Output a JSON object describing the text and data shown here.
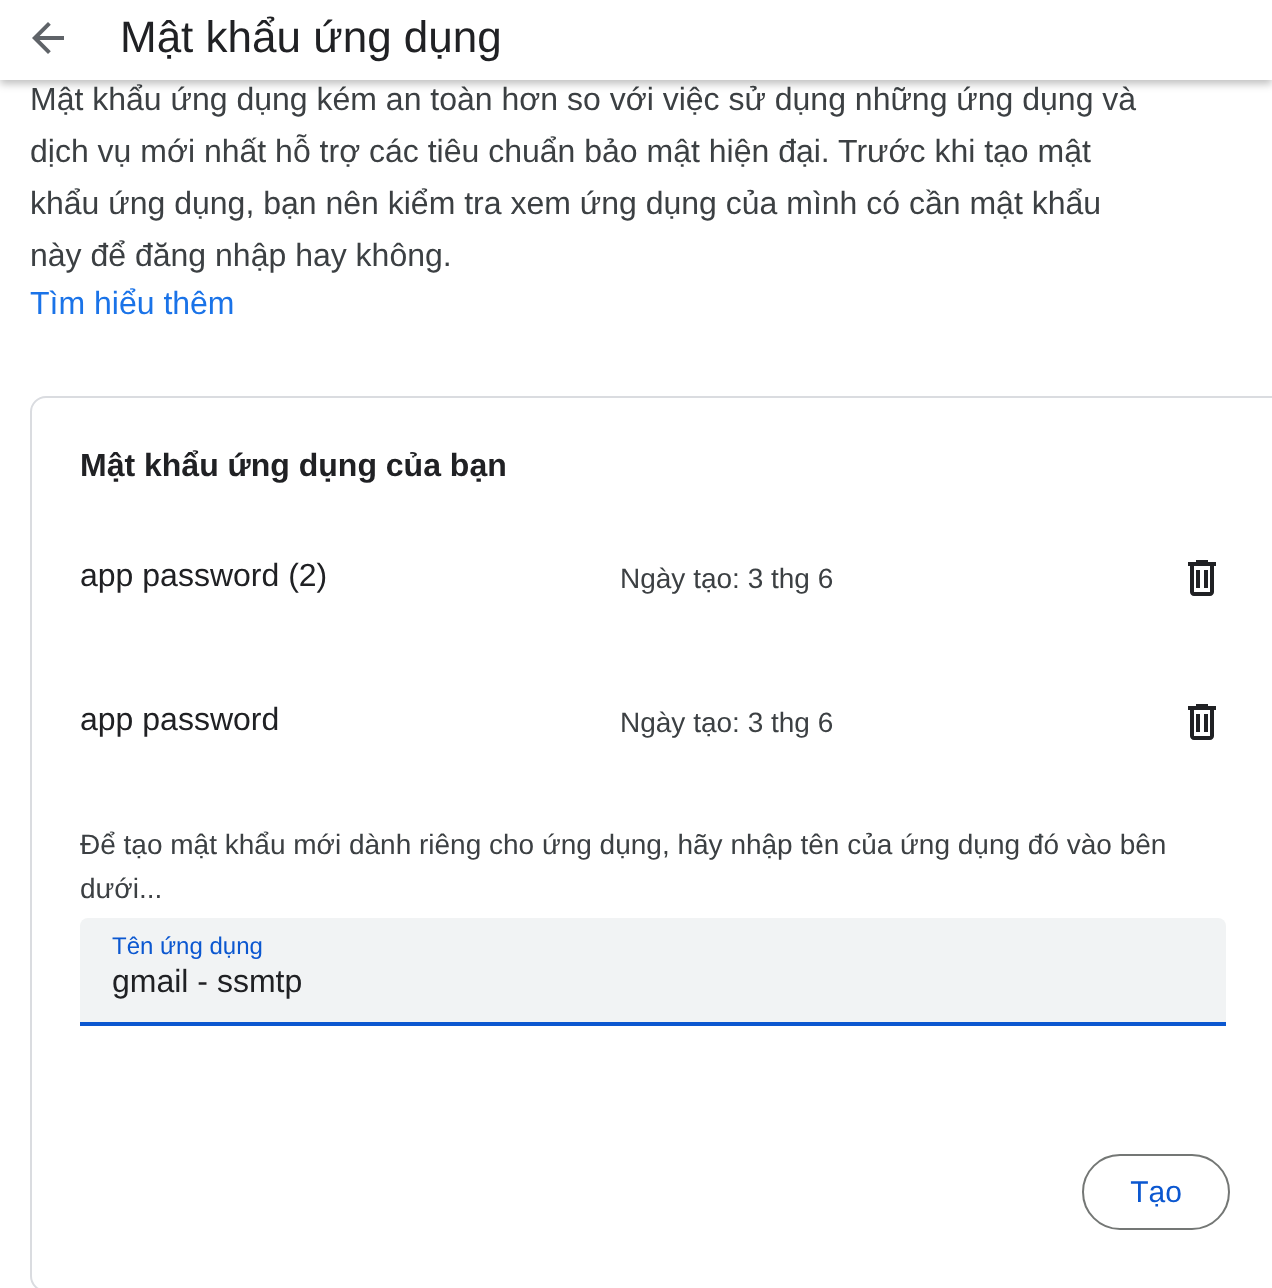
{
  "header": {
    "title": "Mật khẩu ứng dụng"
  },
  "intro": {
    "text": "Mật khẩu ứng dụng kém an toàn hơn so với việc sử dụng những ứng dụng và dịch vụ mới nhất hỗ trợ các tiêu chuẩn bảo mật hiện đại. Trước khi tạo mật khẩu ứng dụng, bạn nên kiểm tra xem ứng dụng của mình có cần mật khẩu này để đăng nhập hay không.",
    "link": "Tìm hiểu thêm"
  },
  "card": {
    "title": "Mật khẩu ứng dụng của bạn",
    "passwords": [
      {
        "name": "app password (2)",
        "created": "Ngày tạo: 3 thg 6"
      },
      {
        "name": "app password",
        "created": "Ngày tạo: 3 thg 6"
      }
    ],
    "hint": "Để tạo mật khẩu mới dành riêng cho ứng dụng, hãy nhập tên của ứng dụng đó vào bên dưới...",
    "field": {
      "label": "Tên ứng dụng",
      "value": "gmail - ssmtp",
      "focused": true
    },
    "button": "Tạo"
  }
}
